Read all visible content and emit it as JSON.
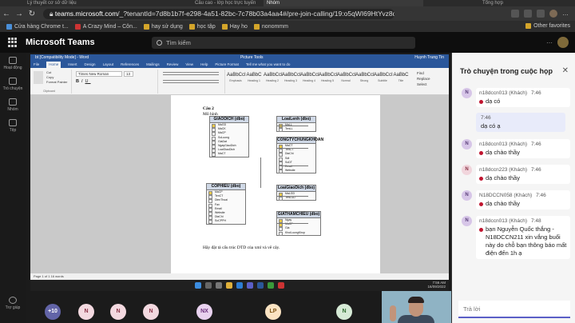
{
  "browser": {
    "tabs": [
      "Lý thuyết cơ sở dữ liệu",
      "Câu cao - lớp học trực tuyến",
      "Nhóm",
      "Tổng hợp"
    ],
    "url_domain": "teams.microsoft.com",
    "url_rest": "/_?tenantId=7d8b1b7f-e298-4a51-82bc-7c78b03a4aa4#/pre-join-calling/19:o5qWI69HtYvz8dlM..."
  },
  "bookmarks": {
    "items": [
      "Cửa hàng Chrome t...",
      "A Crazy Mind – Côn...",
      "hay sử dụng",
      "học tập",
      "Hay ho",
      "nonommm"
    ],
    "other": "Other favorites"
  },
  "teams": {
    "app_title": "Microsoft Teams",
    "search_placeholder": "Tìm kiếm",
    "rail": [
      "Hoạt động",
      "Trò chuyện",
      "Nhóm",
      "Tệp"
    ],
    "rail_bottom": "Trợ giúp"
  },
  "word": {
    "title": "bt [Compatibility Mode] - Word",
    "tab_context": "Picture Tools",
    "user": "Huynh Trung Tin",
    "tabs": [
      "File",
      "Home",
      "Insert",
      "Design",
      "Layout",
      "References",
      "Mailings",
      "Review",
      "View",
      "Help",
      "Picture Format",
      "Tell me what you want to do"
    ],
    "clipboard": [
      "Cut",
      "Copy",
      "Format Painter",
      "Clipboard"
    ],
    "font": "Times New Roman",
    "font_size": "13",
    "styles": [
      {
        "sample": "AaBbCcI",
        "name": "Emphasis"
      },
      {
        "sample": "AaBbC",
        "name": "Heading 1"
      },
      {
        "sample": "AaBbCcI",
        "name": "Heading 2"
      },
      {
        "sample": "AaBbCcI",
        "name": "Heading 3"
      },
      {
        "sample": "AaBbCcI",
        "name": "Heading 4"
      },
      {
        "sample": "AaBbCcI",
        "name": "Heading 5"
      },
      {
        "sample": "AaBbCcI",
        "name": "Normal"
      },
      {
        "sample": "AaBbCcI",
        "name": "Strong"
      },
      {
        "sample": "AaBbCcI",
        "name": "Subtitle"
      },
      {
        "sample": "AaBbC",
        "name": "Title"
      }
    ],
    "editing": [
      "Find",
      "Replace",
      "Select"
    ],
    "doc": {
      "heading": "Câu 2",
      "subheading": "Mô hình",
      "footer": "Hãy đặt tả cấu trúc DTD của xml và vẽ cây."
    },
    "status": "Page 1 of 1   16 words"
  },
  "diagram": {
    "tables": [
      {
        "name": "GIAODICH (dbo)",
        "fields": [
          "MaGD",
          "MaCK",
          "MaCP",
          "SoLuong",
          "GiaDat",
          "NgayGiaoDich",
          "LoaiGiaoDich",
          "MaCT"
        ],
        "keys": [
          0
        ]
      },
      {
        "name": "LoaiLenh (dbo)",
        "fields": [
          "MaLL",
          "TenLL"
        ],
        "keys": [
          0
        ]
      },
      {
        "name": "CONGTYCHUNGKHOAN",
        "fields": [
          "MaCT",
          "TenCT",
          "DiaChi",
          "Sdt",
          "SoDT",
          "Email",
          "Website"
        ],
        "keys": [
          0
        ]
      },
      {
        "name": "COPHIEU (dbo)",
        "fields": [
          "MaCP",
          "TenCT",
          "DienThoai",
          "Fax",
          "Email",
          "Website",
          "DiaChi",
          "SoCPPH"
        ],
        "keys": [
          0
        ]
      },
      {
        "name": "LoaiGiaoDich (dbo)",
        "fields": [
          "MaLGD",
          "TenLGD"
        ],
        "keys": [
          0
        ]
      },
      {
        "name": "GIATHAMCHIEU (dbo)",
        "fields": [
          "Ngay",
          "MaCP",
          "Gia",
          "KhoiLuongKhop"
        ],
        "keys": [
          0,
          1
        ]
      }
    ]
  },
  "taskbar": {
    "time": "7:56 AM",
    "date": "16/09/2022"
  },
  "chat": {
    "title": "Trò chuyện trong cuộc họp",
    "messages": [
      {
        "avatar": "N",
        "sender": "n18dccn013 (Khách)",
        "time": "7:46",
        "text": "dạ có"
      },
      {
        "avatar": "N",
        "sender": "n18dccn013 (Khách)",
        "time": "7:46",
        "text": "dạ chào thầy"
      },
      {
        "avatar": "N",
        "sender": "n18dccn223 (Khách)",
        "time": "7:46",
        "text": "dạ chào thầy"
      },
      {
        "avatar": "N",
        "sender": "N18DCCN058 (Khách)",
        "time": "7:46",
        "text": "dạ chào thầy"
      },
      {
        "avatar": "N",
        "sender": "n18dccn013 (Khách)",
        "time": "7:48",
        "text": "bạn Nguyễn Quốc thắng - N18DCCN211 xin vắng buổi này do chỗ bạn thông báo mất điện đến 1h ạ"
      }
    ],
    "mine": {
      "time": "7:46",
      "text": "dạ có ạ"
    },
    "reply_placeholder": "Trả lời"
  },
  "participants": [
    "+10",
    "N",
    "N",
    "N",
    "NX",
    "LP",
    "N"
  ],
  "colors": {
    "teams_purple": "#5b5fc7",
    "word_blue": "#2b579a",
    "unread": "#c0152f"
  }
}
